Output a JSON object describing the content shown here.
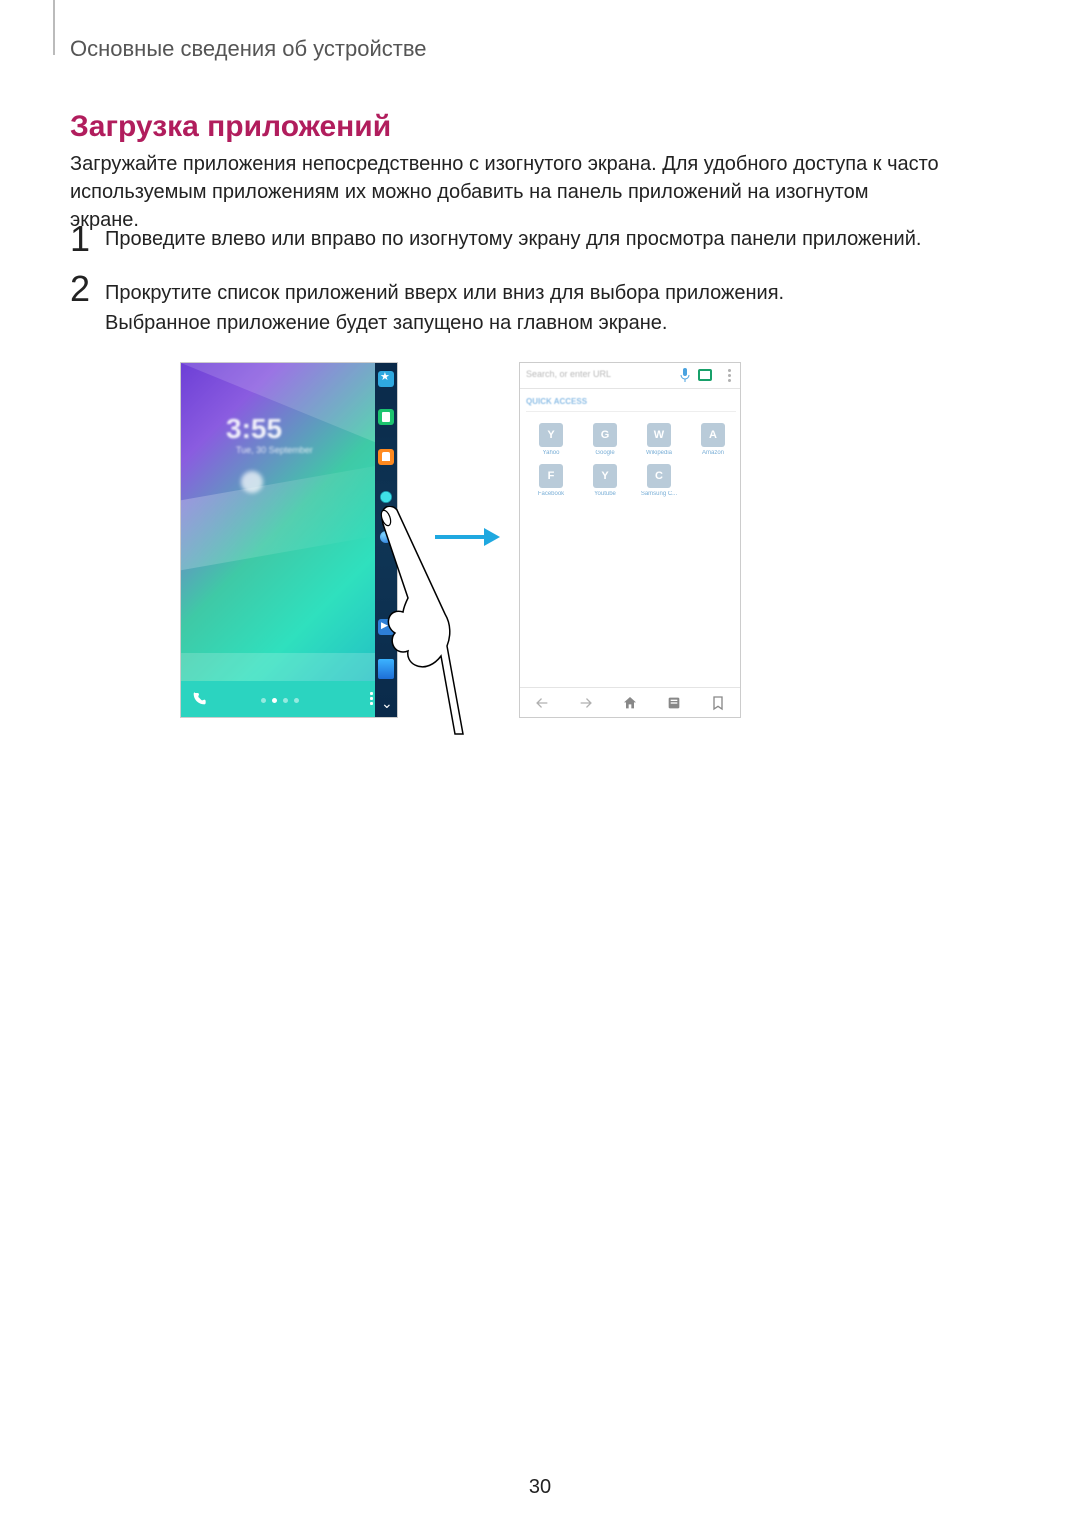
{
  "breadcrumb": "Основные сведения об устройстве",
  "section_title": "Загрузка приложений",
  "intro": "Загружайте приложения непосредственно с изогнутого экрана. Для удобного доступа к часто используемым приложениям их можно добавить на панель приложений на изогнутом экране.",
  "steps": {
    "one_num": "1",
    "one_text": "Проведите влево или вправо по изогнутому экрану для просмотра панели приложений.",
    "two_num": "2",
    "two_text": "Прокрутите список приложений вверх или вниз для выбора приложения.",
    "two_text_b": "Выбранное приложение будет запущено на главном экране."
  },
  "left_screen": {
    "time": "3:55",
    "date": "Tue, 30 September",
    "edge_icons": [
      "star-icon",
      "book-icon",
      "contact-icon",
      "weather-icon",
      "globe-icon",
      "play-icon",
      "store-icon",
      "expand-icon"
    ]
  },
  "right_screen": {
    "url_placeholder": "Search, or enter URL",
    "quick_access_label": "QUICK ACCESS",
    "tiles_row1": [
      {
        "letter": "Y",
        "label": "Yahoo"
      },
      {
        "letter": "G",
        "label": "Google"
      },
      {
        "letter": "W",
        "label": "Wikipedia"
      },
      {
        "letter": "A",
        "label": "Amazon"
      }
    ],
    "tiles_row2": [
      {
        "letter": "F",
        "label": "Facebook"
      },
      {
        "letter": "Y",
        "label": "Youtube"
      },
      {
        "letter": "C",
        "label": "Samsung C..."
      }
    ],
    "nav_icons": [
      "back-icon",
      "forward-icon",
      "home-icon",
      "tabs-icon",
      "bookmark-icon"
    ]
  },
  "page_number": "30"
}
